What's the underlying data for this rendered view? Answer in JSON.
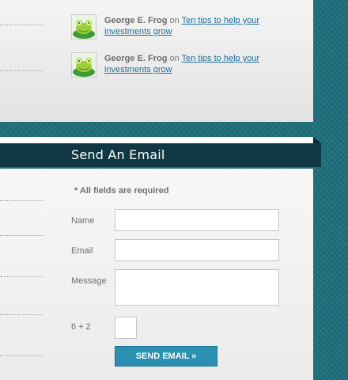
{
  "recent_comments": [
    {
      "author": "George E. Frog",
      "connector": "on",
      "post_title": "Ten tips to help your investments grow",
      "avatar_icon": "frog-avatar-icon"
    },
    {
      "author": "George E. Frog",
      "connector": "on",
      "post_title": "Ten tips to help your investments grow",
      "avatar_icon": "frog-avatar-icon"
    }
  ],
  "email_form": {
    "title": "Send An Email",
    "required_note": "* All fields are required",
    "name_label": "Name",
    "name_value": "",
    "email_label": "Email",
    "email_value": "",
    "message_label": "Message",
    "message_value": "",
    "captcha_label": "6 + 2",
    "captcha_value": "",
    "submit_label": "SEND EMAIL »"
  },
  "colors": {
    "header_bar": "#0f3844",
    "button": "#2a8fb1",
    "link": "#1e6f99",
    "page_background": "#1f6f7d"
  }
}
